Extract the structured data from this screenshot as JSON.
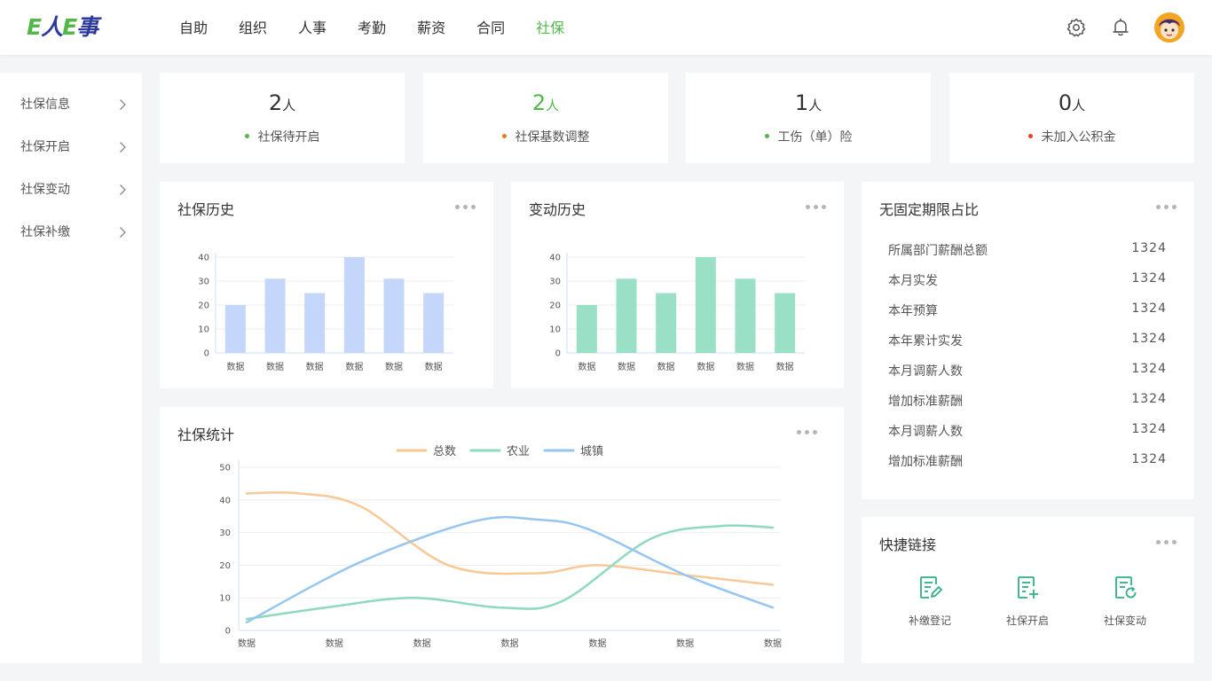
{
  "brand": {
    "logo_text_1": "E",
    "logo_text_2": "人",
    "logo_text_3": "E",
    "logo_text_4": "事"
  },
  "nav": [
    "自助",
    "组织",
    "人事",
    "考勤",
    "薪资",
    "合同",
    "社保"
  ],
  "nav_active": "社保",
  "header_icons": [
    "settings-icon",
    "bell-icon",
    "avatar"
  ],
  "sidebar": [
    "社保信息",
    "社保开启",
    "社保变动",
    "社保补缴"
  ],
  "stats": [
    {
      "value": "2",
      "unit": "人",
      "label": "社保待开启",
      "dot_color": "#52b848",
      "highlight": false
    },
    {
      "value": "2",
      "unit": "人",
      "label": "社保基数调整",
      "dot_color": "#e57a2b",
      "highlight": true
    },
    {
      "value": "1",
      "unit": "人",
      "label": "工伤（单）险",
      "dot_color": "#52b848",
      "highlight": false
    },
    {
      "value": "0",
      "unit": "人",
      "label": "未加入公积金",
      "dot_color": "#e5402b",
      "highlight": false
    }
  ],
  "cards": {
    "history": "社保历史",
    "change": "变动历史",
    "ratio": "无固定期限占比",
    "stats": "社保统计",
    "quick": "快捷链接"
  },
  "ratio_rows": [
    {
      "label": "所属部门薪酬总额",
      "value": "1324"
    },
    {
      "label": "本月实发",
      "value": "1324"
    },
    {
      "label": "本年预算",
      "value": "1324"
    },
    {
      "label": "本年累计实发",
      "value": "1324"
    },
    {
      "label": "本月调薪人数",
      "value": "1324"
    },
    {
      "label": "增加标准薪酬",
      "value": "1324"
    },
    {
      "label": "本月调薪人数",
      "value": "1324"
    },
    {
      "label": "增加标准薪酬",
      "value": "1324"
    }
  ],
  "quick_links": [
    {
      "label": "补缴登记",
      "icon": "document-edit-icon"
    },
    {
      "label": "社保开启",
      "icon": "document-add-icon"
    },
    {
      "label": "社保变动",
      "icon": "document-refresh-icon"
    }
  ],
  "chart_data": [
    {
      "type": "bar",
      "categories": [
        "数据",
        "数据",
        "数据",
        "数据",
        "数据",
        "数据"
      ],
      "values": [
        20,
        31,
        25,
        40,
        31,
        25
      ],
      "ylim": [
        0,
        40
      ],
      "yticks": [
        0,
        10,
        20,
        30,
        40
      ],
      "color": "#c5d6fb"
    },
    {
      "type": "bar",
      "categories": [
        "数据",
        "数据",
        "数据",
        "数据",
        "数据",
        "数据"
      ],
      "values": [
        20,
        31,
        25,
        40,
        31,
        25
      ],
      "ylim": [
        0,
        40
      ],
      "yticks": [
        0,
        10,
        20,
        30,
        40
      ],
      "color": "#9ae0c6"
    },
    {
      "type": "line",
      "categories": [
        "数据",
        "数据",
        "数据",
        "数据",
        "数据",
        "数据",
        "数据"
      ],
      "ylim": [
        0,
        50
      ],
      "yticks": [
        0,
        10,
        20,
        30,
        40,
        50
      ],
      "legend_position": "top-center",
      "series": [
        {
          "name": "总数",
          "color": "#f8c896",
          "points": [
            [
              0,
              42
            ],
            [
              0.6,
              42
            ],
            [
              1.3,
              38
            ],
            [
              2.3,
              20
            ],
            [
              3.3,
              17.5
            ],
            [
              4.0,
              20
            ],
            [
              5.0,
              17
            ],
            [
              6.0,
              14
            ]
          ]
        },
        {
          "name": "农业",
          "color": "#8ed9c0",
          "points": [
            [
              0,
              3.5
            ],
            [
              0.9,
              7
            ],
            [
              1.9,
              10
            ],
            [
              2.9,
              7
            ],
            [
              3.6,
              9
            ],
            [
              4.6,
              28
            ],
            [
              5.4,
              32
            ],
            [
              6.0,
              31.5
            ]
          ]
        },
        {
          "name": "城镇",
          "color": "#96c6f0",
          "points": [
            [
              0,
              2.5
            ],
            [
              1.3,
              21
            ],
            [
              2.6,
              33.5
            ],
            [
              3.3,
              34
            ],
            [
              3.9,
              31
            ],
            [
              5.0,
              17
            ],
            [
              6.0,
              7
            ]
          ]
        }
      ]
    }
  ]
}
